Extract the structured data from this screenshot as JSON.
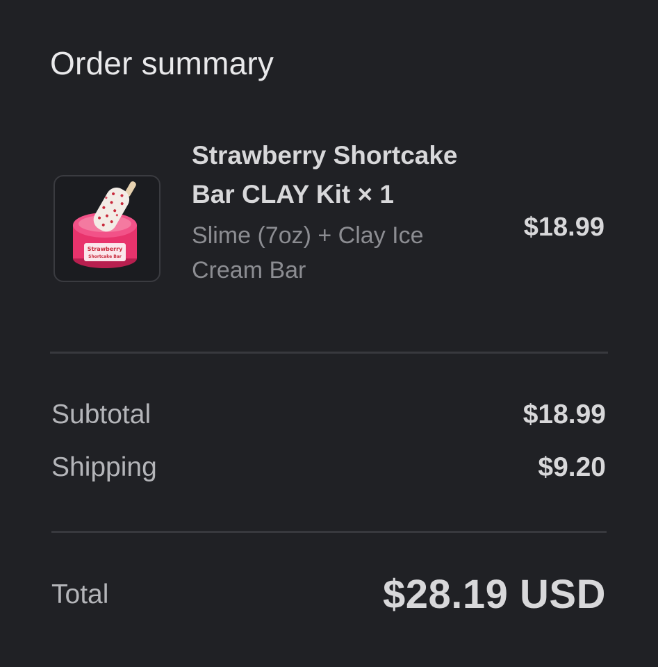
{
  "summary": {
    "title": "Order summary"
  },
  "item": {
    "name": "Strawberry Shortcake Bar CLAY Kit × 1",
    "variant": "Slime (7oz) + Clay Ice Cream Bar",
    "price": "$18.99",
    "image_label_line1": "Strawberry",
    "image_label_line2": "Shortcake Bar",
    "colors": {
      "slime": "#e8336c",
      "slime_light": "#f47aa0",
      "bar": "#f3ece6",
      "sprinkle": "#c8283a",
      "stick": "#e7d2b0"
    }
  },
  "totals": {
    "subtotal_label": "Subtotal",
    "subtotal_value": "$18.99",
    "shipping_label": "Shipping",
    "shipping_value": "$9.20",
    "total_label": "Total",
    "total_value": "$28.19 USD"
  }
}
